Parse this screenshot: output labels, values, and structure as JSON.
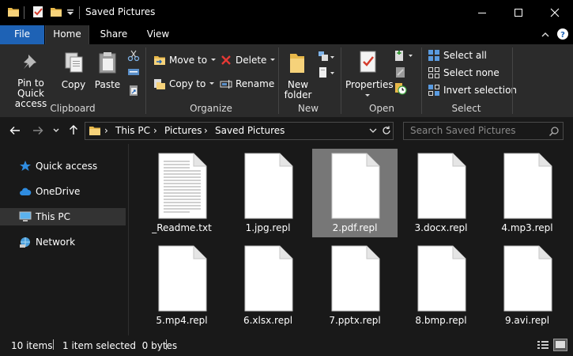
{
  "window": {
    "title": "Saved Pictures"
  },
  "tabs": {
    "file": "File",
    "home": "Home",
    "share": "Share",
    "view": "View"
  },
  "ribbon": {
    "clipboard": {
      "pin": "Pin to Quick access",
      "copy": "Copy",
      "paste": "Paste",
      "label": "Clipboard"
    },
    "organize": {
      "move_to": "Move to",
      "copy_to": "Copy to",
      "delete": "Delete",
      "rename": "Rename",
      "label": "Organize"
    },
    "new": {
      "new_folder": "New folder",
      "label": "New"
    },
    "open": {
      "properties": "Properties",
      "label": "Open"
    },
    "select": {
      "select_all": "Select all",
      "select_none": "Select none",
      "invert": "Invert selection",
      "label": "Select"
    }
  },
  "address": {
    "crumbs": [
      "This PC",
      "Pictures",
      "Saved Pictures"
    ],
    "search_placeholder": "Search Saved Pictures"
  },
  "nav": {
    "quick_access": "Quick access",
    "onedrive": "OneDrive",
    "this_pc": "This PC",
    "network": "Network"
  },
  "files": [
    {
      "name": "_Readme.txt",
      "selected": false
    },
    {
      "name": "1.jpg.repl",
      "selected": false
    },
    {
      "name": "2.pdf.repl",
      "selected": true
    },
    {
      "name": "3.docx.repl",
      "selected": false
    },
    {
      "name": "4.mp3.repl",
      "selected": false
    },
    {
      "name": "5.mp4.repl",
      "selected": false
    },
    {
      "name": "6.xlsx.repl",
      "selected": false
    },
    {
      "name": "7.pptx.repl",
      "selected": false
    },
    {
      "name": "8.bmp.repl",
      "selected": false
    },
    {
      "name": "9.avi.repl",
      "selected": false
    }
  ],
  "status": {
    "items": "10 items",
    "selected": "1 item selected  0 bytes"
  },
  "colors": {
    "accent": "#1e62b5",
    "selected_tile": "#777777",
    "background": "#191919",
    "ribbon": "#2b2b2b"
  }
}
